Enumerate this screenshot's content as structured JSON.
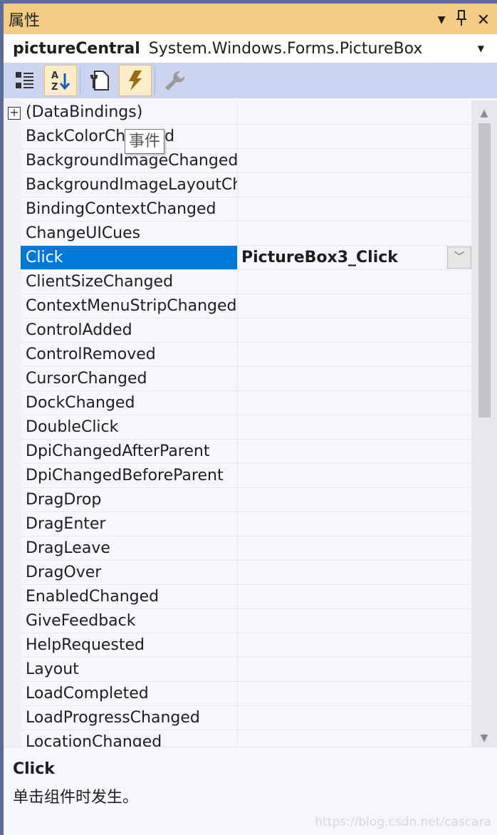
{
  "window": {
    "title": "属性",
    "dropdown_icon": "▾",
    "pin_icon": "pin",
    "close_icon": "×"
  },
  "selector": {
    "name": "pictureCentral",
    "type": "System.Windows.Forms.PictureBox"
  },
  "toolbar": {
    "buttons": [
      {
        "icon": "categorized-icon",
        "active": false
      },
      {
        "icon": "alphabetical-icon",
        "active": true
      },
      {
        "icon": "properties-icon",
        "active": false
      },
      {
        "icon": "events-icon",
        "active": true
      },
      {
        "icon": "property-pages-icon",
        "active": false
      }
    ]
  },
  "tooltip": "事件",
  "grid": {
    "rows": [
      {
        "name": "(DataBindings)",
        "value": ""
      },
      {
        "name": "BackColorChanged",
        "value": ""
      },
      {
        "name": "BackgroundImageChanged",
        "value": ""
      },
      {
        "name": "BackgroundImageLayoutChanged",
        "value": ""
      },
      {
        "name": "BindingContextChanged",
        "value": ""
      },
      {
        "name": "ChangeUICues",
        "value": ""
      },
      {
        "name": "Click",
        "value": "PictureBox3_Click",
        "selected": true
      },
      {
        "name": "ClientSizeChanged",
        "value": ""
      },
      {
        "name": "ContextMenuStripChanged",
        "value": ""
      },
      {
        "name": "ControlAdded",
        "value": ""
      },
      {
        "name": "ControlRemoved",
        "value": ""
      },
      {
        "name": "CursorChanged",
        "value": ""
      },
      {
        "name": "DockChanged",
        "value": ""
      },
      {
        "name": "DoubleClick",
        "value": ""
      },
      {
        "name": "DpiChangedAfterParent",
        "value": ""
      },
      {
        "name": "DpiChangedBeforeParent",
        "value": ""
      },
      {
        "name": "DragDrop",
        "value": ""
      },
      {
        "name": "DragEnter",
        "value": ""
      },
      {
        "name": "DragLeave",
        "value": ""
      },
      {
        "name": "DragOver",
        "value": ""
      },
      {
        "name": "EnabledChanged",
        "value": ""
      },
      {
        "name": "GiveFeedback",
        "value": ""
      },
      {
        "name": "HelpRequested",
        "value": ""
      },
      {
        "name": "Layout",
        "value": ""
      },
      {
        "name": "LoadCompleted",
        "value": ""
      },
      {
        "name": "LoadProgressChanged",
        "value": ""
      },
      {
        "name": "LocationChanged",
        "value": ""
      }
    ]
  },
  "description": {
    "title": "Click",
    "text": "单击组件时发生。"
  },
  "watermark": "https://blog.csdn.net/cascara",
  "colors": {
    "titlebar": "#f5cc84",
    "toolbar": "#ccd5f0",
    "selection": "#0078d7",
    "frame": "#5d6b99"
  }
}
